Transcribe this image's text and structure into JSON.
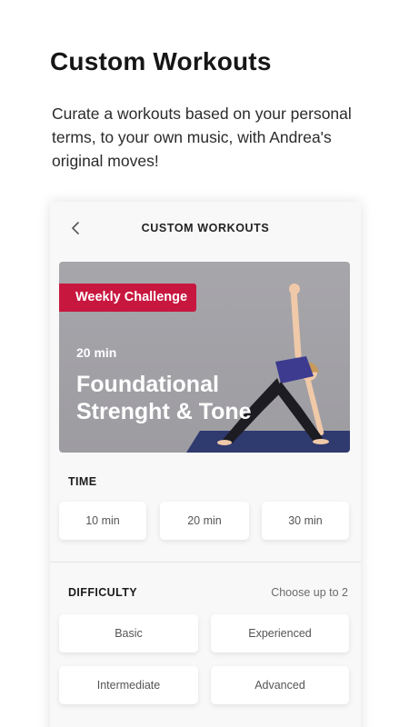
{
  "intro": {
    "title": "Custom Workouts",
    "description": "Curate a workouts based on your personal terms, to your own music, with Andrea's original moves!"
  },
  "screen": {
    "nav_title": "CUSTOM WORKOUTS",
    "back_icon": "chevron-left-icon",
    "hero": {
      "badge": "Weekly Challenge",
      "duration": "20 min",
      "title": "Foundational Strenght & Tone"
    },
    "time": {
      "label": "TIME",
      "options": [
        "10 min",
        "20 min",
        "30 min"
      ]
    },
    "difficulty": {
      "label": "DIFFICULTY",
      "note": "Choose up to 2",
      "options": [
        "Basic",
        "Experienced",
        "Intermediate",
        "Advanced"
      ]
    },
    "colors": {
      "accent": "#c8173f",
      "hero_bg": "#a7a6ab",
      "card_bg": "#f8f8f8"
    }
  }
}
